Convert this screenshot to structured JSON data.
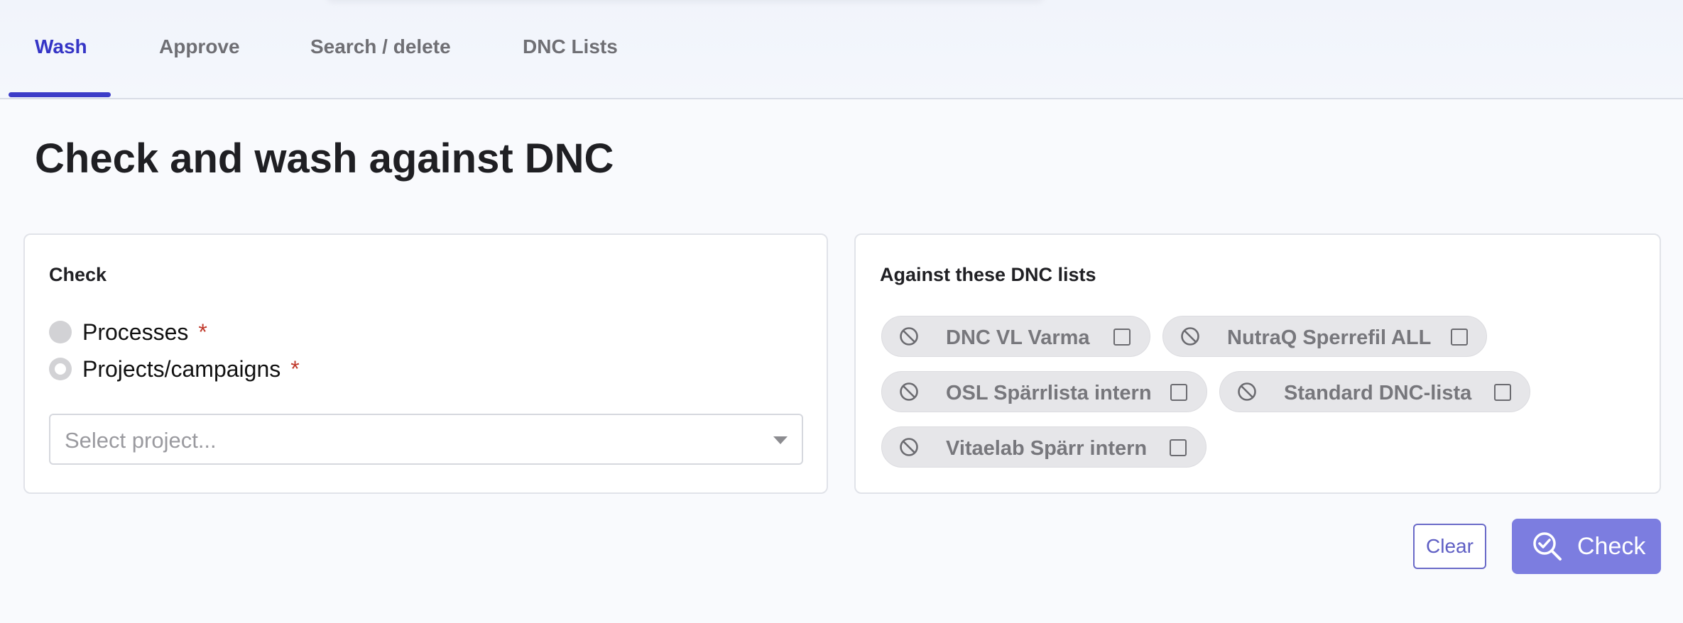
{
  "tabs": [
    {
      "label": "Wash",
      "active": true
    },
    {
      "label": "Approve",
      "active": false
    },
    {
      "label": "Search / delete",
      "active": false
    },
    {
      "label": "DNC Lists",
      "active": false
    }
  ],
  "page_title": "Check and wash against DNC",
  "check_card": {
    "title": "Check",
    "options": [
      {
        "label": "Processes",
        "required_mark": "*",
        "selected": false
      },
      {
        "label": "Projects/campaigns",
        "required_mark": "*",
        "selected": false
      }
    ],
    "project_select": {
      "placeholder": "Select project..."
    }
  },
  "dnc_card": {
    "title": "Against these DNC lists",
    "lists": [
      {
        "label": "DNC VL Varma",
        "checked": false
      },
      {
        "label": "NutraQ Sperrefil ALL",
        "checked": false
      },
      {
        "label": "OSL Spärrlista intern",
        "checked": false
      },
      {
        "label": "Standard DNC-lista",
        "checked": false
      },
      {
        "label": "Vitaelab Spärr intern",
        "checked": false
      }
    ],
    "icon": "ban-icon"
  },
  "actions": {
    "clear_label": "Clear",
    "check_label": "Check"
  },
  "colors": {
    "accent": "#3c3cc8",
    "primary_button": "#7c7de0",
    "required": "#c0392b",
    "chip_bg": "#e6e6e9"
  }
}
